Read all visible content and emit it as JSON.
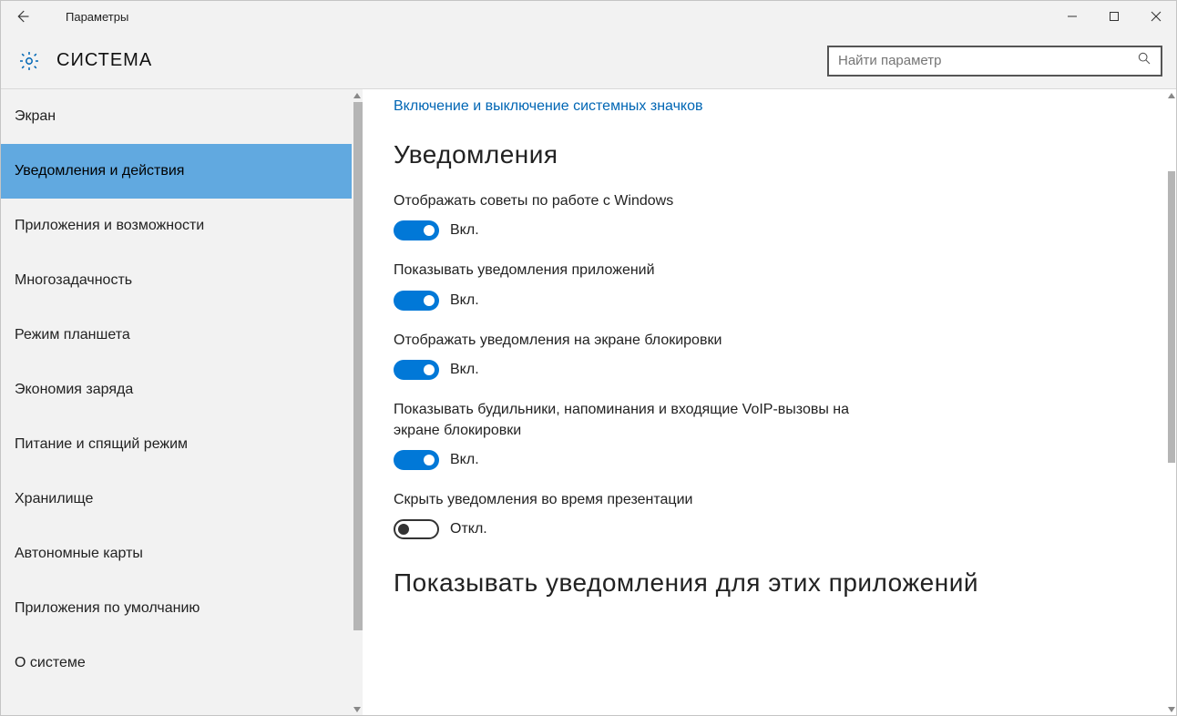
{
  "window": {
    "title": "Параметры"
  },
  "header": {
    "section": "СИСТЕМА"
  },
  "search": {
    "placeholder": "Найти параметр"
  },
  "sidebar": {
    "items": [
      {
        "label": "Экран"
      },
      {
        "label": "Уведомления и действия",
        "selected": true
      },
      {
        "label": "Приложения и возможности"
      },
      {
        "label": "Многозадачность"
      },
      {
        "label": "Режим планшета"
      },
      {
        "label": "Экономия заряда"
      },
      {
        "label": "Питание и спящий режим"
      },
      {
        "label": "Хранилище"
      },
      {
        "label": "Автономные карты"
      },
      {
        "label": "Приложения по умолчанию"
      },
      {
        "label": "О системе"
      }
    ]
  },
  "content": {
    "top_link": "Включение и выключение системных значков",
    "notifications_heading": "Уведомления",
    "toggle_on_text": "Вкл.",
    "toggle_off_text": "Откл.",
    "settings": [
      {
        "label": "Отображать советы по работе с Windows",
        "on": true
      },
      {
        "label": "Показывать уведомления приложений",
        "on": true
      },
      {
        "label": "Отображать уведомления на экране блокировки",
        "on": true
      },
      {
        "label": "Показывать будильники, напоминания и входящие VoIP-вызовы на экране блокировки",
        "on": true
      },
      {
        "label": "Скрыть уведомления во время презентации",
        "on": false
      }
    ],
    "apps_heading": "Показывать уведомления для этих приложений"
  }
}
